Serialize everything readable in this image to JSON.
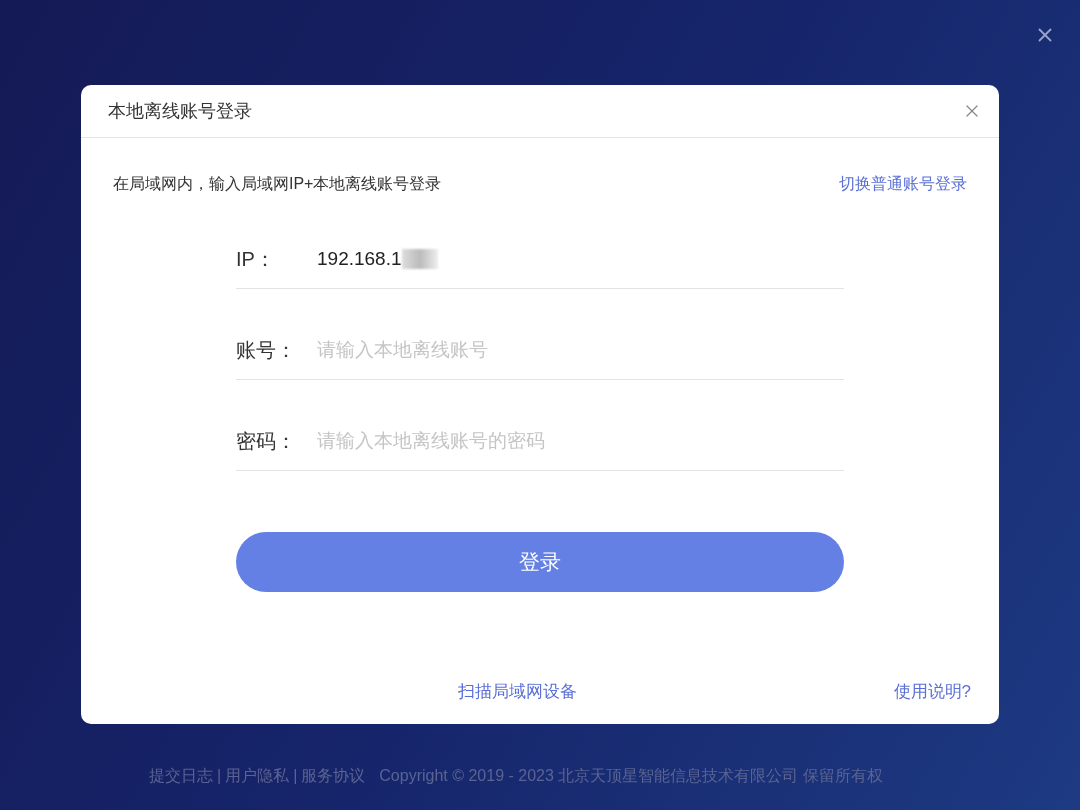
{
  "dialog": {
    "title": "本地离线账号登录",
    "hint": "在局域网内，输入局域网IP+本地离线账号登录",
    "switch_link": "切换普通账号登录",
    "fields": [
      {
        "label": "IP：",
        "value": "192.168.1",
        "redacted": true
      },
      {
        "label": "账号：",
        "placeholder": "请输入本地离线账号"
      },
      {
        "label": "密码：",
        "placeholder": "请输入本地离线账号的密码"
      }
    ],
    "login_button": "登录",
    "scan_link": "扫描局域网设备",
    "help_link": "使用说明?"
  },
  "footer": {
    "links": [
      "提交日志",
      "用户隐私",
      "服务协议"
    ],
    "separator": "|",
    "copyright": "Copyright © 2019 - 2023 北京天顶星智能信息技术有限公司 保留所有权"
  }
}
